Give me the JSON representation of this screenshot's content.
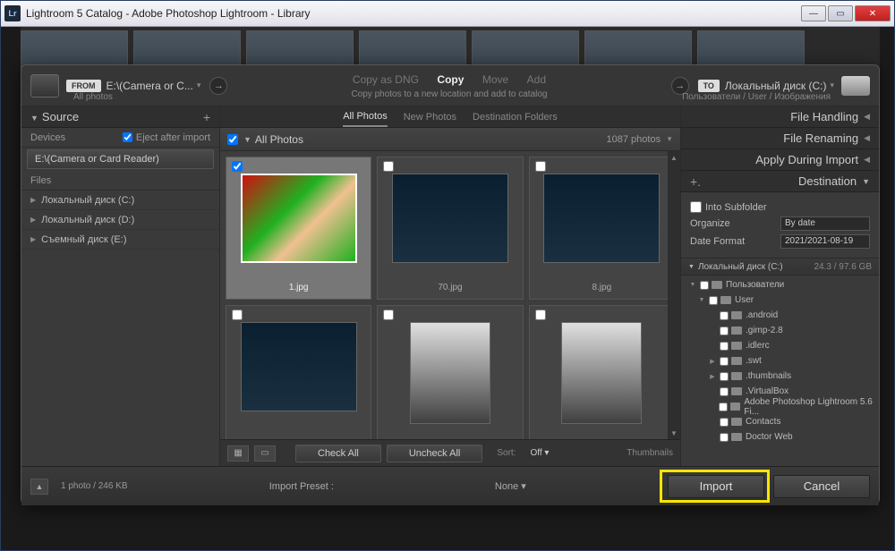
{
  "window": {
    "title": "Lightroom 5 Catalog - Adobe Photoshop Lightroom - Library",
    "lr_icon": "Lr"
  },
  "import": {
    "from_badge": "FROM",
    "from_path": "E:\\(Camera or C...",
    "from_sub": "All photos",
    "actions": {
      "copy_dng": "Copy as DNG",
      "copy": "Copy",
      "move": "Move",
      "add": "Add",
      "sub": "Copy photos to a new location and add to catalog"
    },
    "to_badge": "TO",
    "to_path": "Локальный диск (C:)",
    "to_sub": "Пользователи / User / Изображения"
  },
  "source": {
    "header": "Source",
    "devices_label": "Devices",
    "eject_label": "Eject after import",
    "device": "E:\\(Camera or Card Reader)",
    "files_label": "Files",
    "volumes": [
      "Локальный диск (C:)",
      "Локальный диск (D:)",
      "Съемный диск (E:)"
    ]
  },
  "tabs": {
    "all": "All Photos",
    "new": "New Photos",
    "dest": "Destination Folders"
  },
  "all_photos": {
    "label": "All Photos",
    "count": "1087 photos"
  },
  "thumbs": [
    {
      "file": "1.jpg",
      "checked": true,
      "kind": "baby"
    },
    {
      "file": "70.jpg",
      "checked": false,
      "kind": "chair"
    },
    {
      "file": "8.jpg",
      "checked": false,
      "kind": "chair"
    },
    {
      "file": "",
      "checked": false,
      "kind": "chair"
    },
    {
      "file": "",
      "checked": false,
      "kind": "portrait"
    },
    {
      "file": "",
      "checked": false,
      "kind": "portrait"
    }
  ],
  "center_bottom": {
    "check_all": "Check All",
    "uncheck_all": "Uncheck All",
    "sort_label": "Sort:",
    "sort_value": "Off",
    "thumbs_label": "Thumbnails"
  },
  "right": {
    "file_handling": "File Handling",
    "file_renaming": "File Renaming",
    "apply_during": "Apply During Import",
    "destination": "Destination",
    "into_sub": "Into Subfolder",
    "organize_label": "Organize",
    "organize_value": "By date",
    "dateformat_label": "Date Format",
    "dateformat_value": "2021/2021-08-19",
    "volume_name": "Локальный диск (C:)",
    "volume_size": "24.3 / 97.6 GB",
    "tree": [
      {
        "d": 0,
        "label": "Пользователи",
        "exp": true
      },
      {
        "d": 1,
        "label": "User",
        "exp": true
      },
      {
        "d": 2,
        "label": ".android"
      },
      {
        "d": 2,
        "label": ".gimp-2.8"
      },
      {
        "d": 2,
        "label": ".idlerc"
      },
      {
        "d": 2,
        "label": ".swt",
        "arrow": true
      },
      {
        "d": 2,
        "label": ".thumbnails",
        "arrow": true
      },
      {
        "d": 2,
        "label": ".VirtualBox"
      },
      {
        "d": 2,
        "label": "Adobe Photoshop Lightroom 5.6 Fi..."
      },
      {
        "d": 2,
        "label": "Contacts"
      },
      {
        "d": 2,
        "label": "Doctor Web"
      }
    ]
  },
  "bottom": {
    "status": "1 photo / 246 KB",
    "preset_label": "Import Preset :",
    "preset_value": "None",
    "import": "Import",
    "cancel": "Cancel"
  }
}
